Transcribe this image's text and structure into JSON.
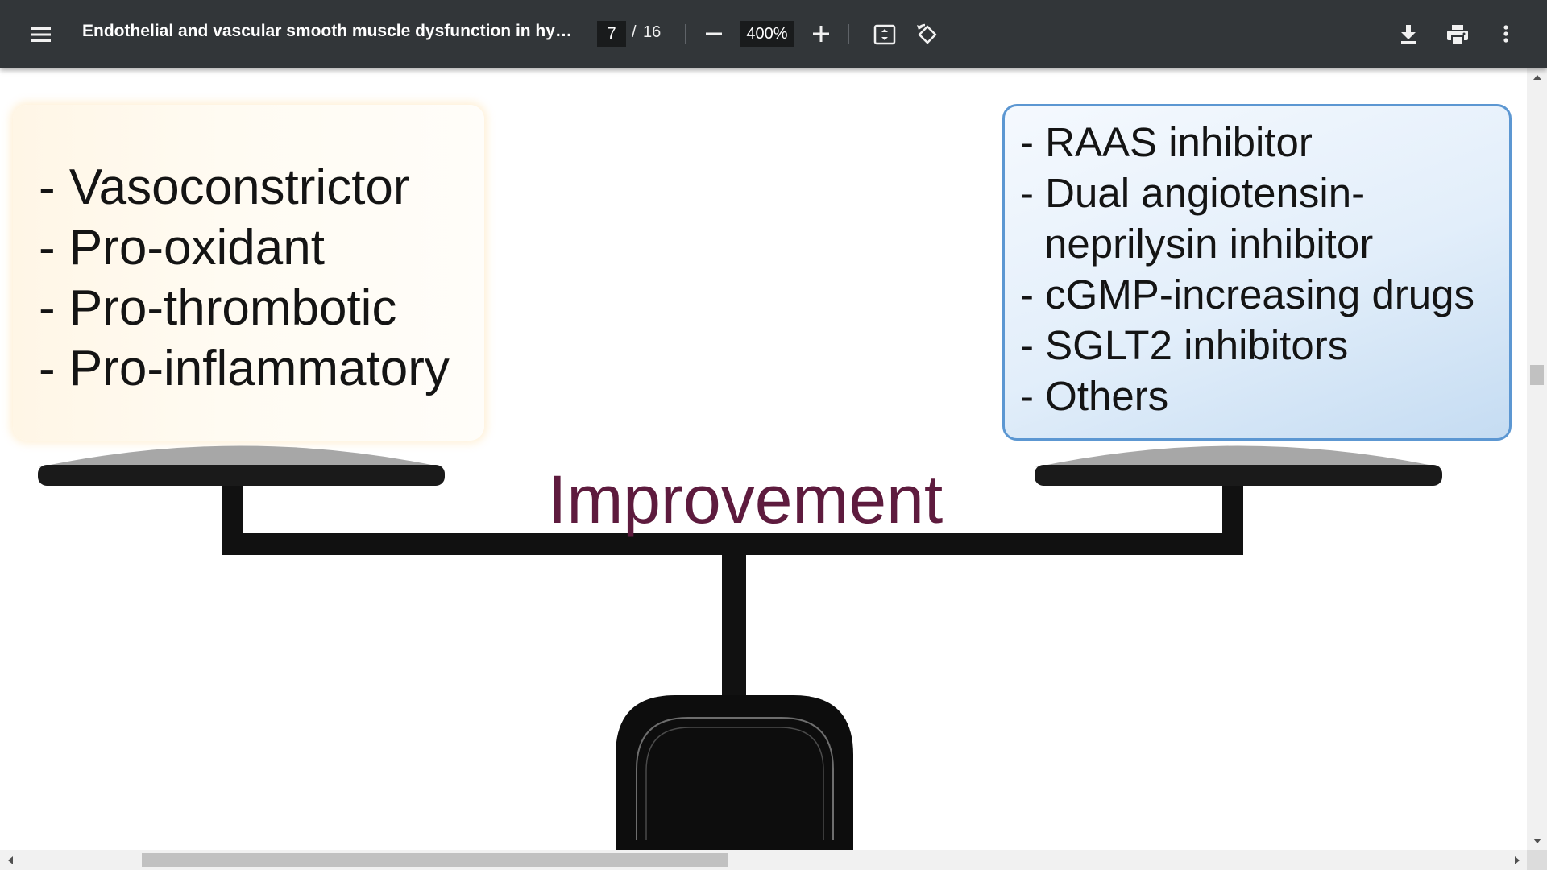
{
  "toolbar": {
    "menu_icon": "hamburger-menu-icon",
    "title": "Endothelial and vascular smooth muscle dysfunction in hyperte...",
    "page_current": "7",
    "page_separator": "/",
    "page_total": "16",
    "zoom_level": "400%",
    "icons": {
      "zoom_out": "minus-icon",
      "zoom_in": "plus-icon",
      "fit": "fit-to-page-icon",
      "rotate": "rotate-counterclockwise-icon",
      "download": "download-icon",
      "print": "print-icon",
      "more": "more-vertical-icon"
    },
    "colors": {
      "bar": "#323639",
      "input": "#191b1c",
      "text": "#f1f1f1"
    }
  },
  "figure": {
    "left_list": [
      "- Vasoconstrictor",
      "- Pro-oxidant",
      "- Pro-thrombotic",
      "- Pro-inflammatory"
    ],
    "right_list": {
      "item1": "- RAAS inhibitor",
      "item2": "- Dual angiotensin-",
      "item2_cont": "neprilysin inhibitor",
      "item3": "- cGMP-increasing drugs",
      "item4": "- SGLT2 inhibitors",
      "item5": "- Others"
    },
    "center_label": "Improvement",
    "colors": {
      "label": "#5e1b3e",
      "scale": "#111111",
      "pan_top": "#a7a7a7",
      "left_panel": "#fff6e6",
      "right_panel": "#dbe9f8",
      "right_border": "#5c97d2"
    }
  }
}
